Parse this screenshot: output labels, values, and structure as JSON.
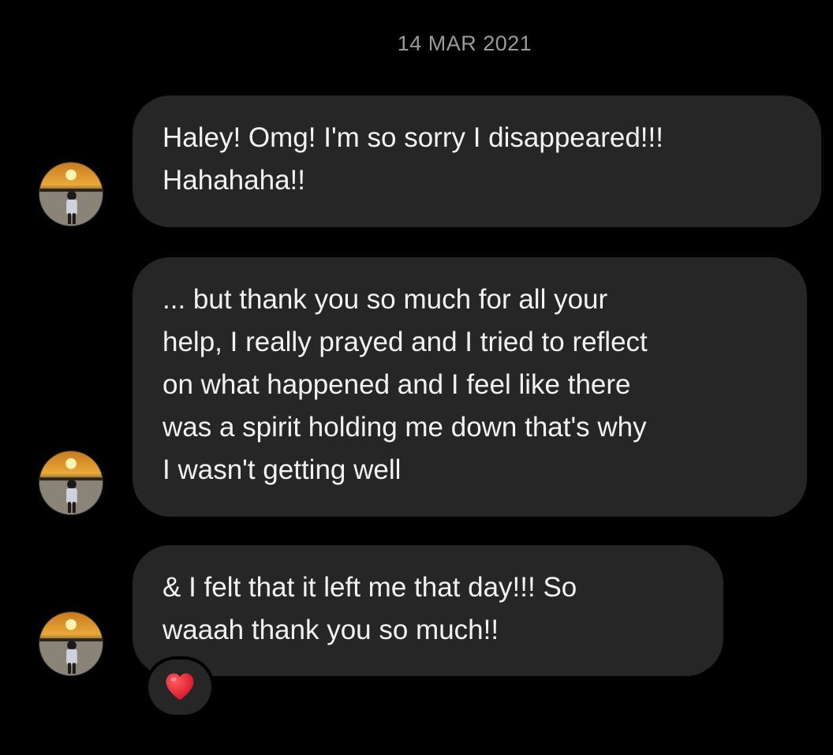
{
  "date_separator": "14 MAR 2021",
  "messages": [
    {
      "lines": [
        "Haley! Omg! I'm so sorry I disappeared!!!",
        "Hahahaha!!"
      ],
      "avatar_icon": "sunset-profile-avatar"
    },
    {
      "lines": [
        "... but thank you so much for all your",
        "help, I really prayed and I tried to reflect",
        "on what happened and I feel like there",
        "was a spirit holding me down that's why",
        "I wasn't getting well"
      ],
      "avatar_icon": "sunset-profile-avatar"
    },
    {
      "lines": [
        "& I felt that it left me that day!!! So",
        "waaah thank you so much!!"
      ],
      "avatar_icon": "sunset-profile-avatar",
      "reaction": {
        "icon": "red-heart-icon",
        "color": "#e8202a"
      }
    }
  ],
  "colors": {
    "background": "#000000",
    "bubble": "#262626",
    "text": "#f2f2f2",
    "date_text": "#9a9a9a"
  }
}
